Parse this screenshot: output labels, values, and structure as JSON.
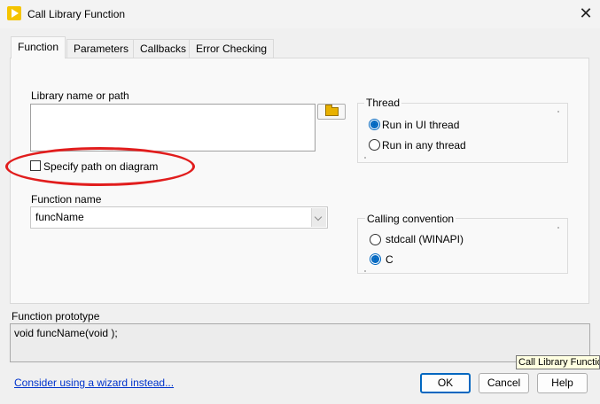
{
  "window": {
    "title": "Call Library Function",
    "close_glyph": "✕"
  },
  "tabs": [
    {
      "label": "Function",
      "active": true
    },
    {
      "label": "Parameters",
      "active": false
    },
    {
      "label": "Callbacks",
      "active": false
    },
    {
      "label": "Error Checking",
      "active": false
    }
  ],
  "library": {
    "label": "Library name or path",
    "value": "",
    "specify_path_label": "Specify path on diagram",
    "specify_path_checked": false
  },
  "function": {
    "label": "Function name",
    "value": "funcName"
  },
  "thread": {
    "title": "Thread",
    "options": [
      "Run in UI thread",
      "Run in any thread"
    ],
    "selected": "Run in UI thread"
  },
  "calling_convention": {
    "title": "Calling convention",
    "options": [
      "stdcall (WINAPI)",
      "C"
    ],
    "selected": "C"
  },
  "prototype": {
    "label": "Function prototype",
    "value": "void  funcName(void );"
  },
  "footer": {
    "wizard_link": "Consider using a wizard instead...",
    "ok": "OK",
    "cancel": "Cancel",
    "help": "Help"
  },
  "tooltip": "Call Library Function",
  "colors": {
    "accent": "#0067c0",
    "highlight": "#e11d1d",
    "link": "#0033cc"
  }
}
